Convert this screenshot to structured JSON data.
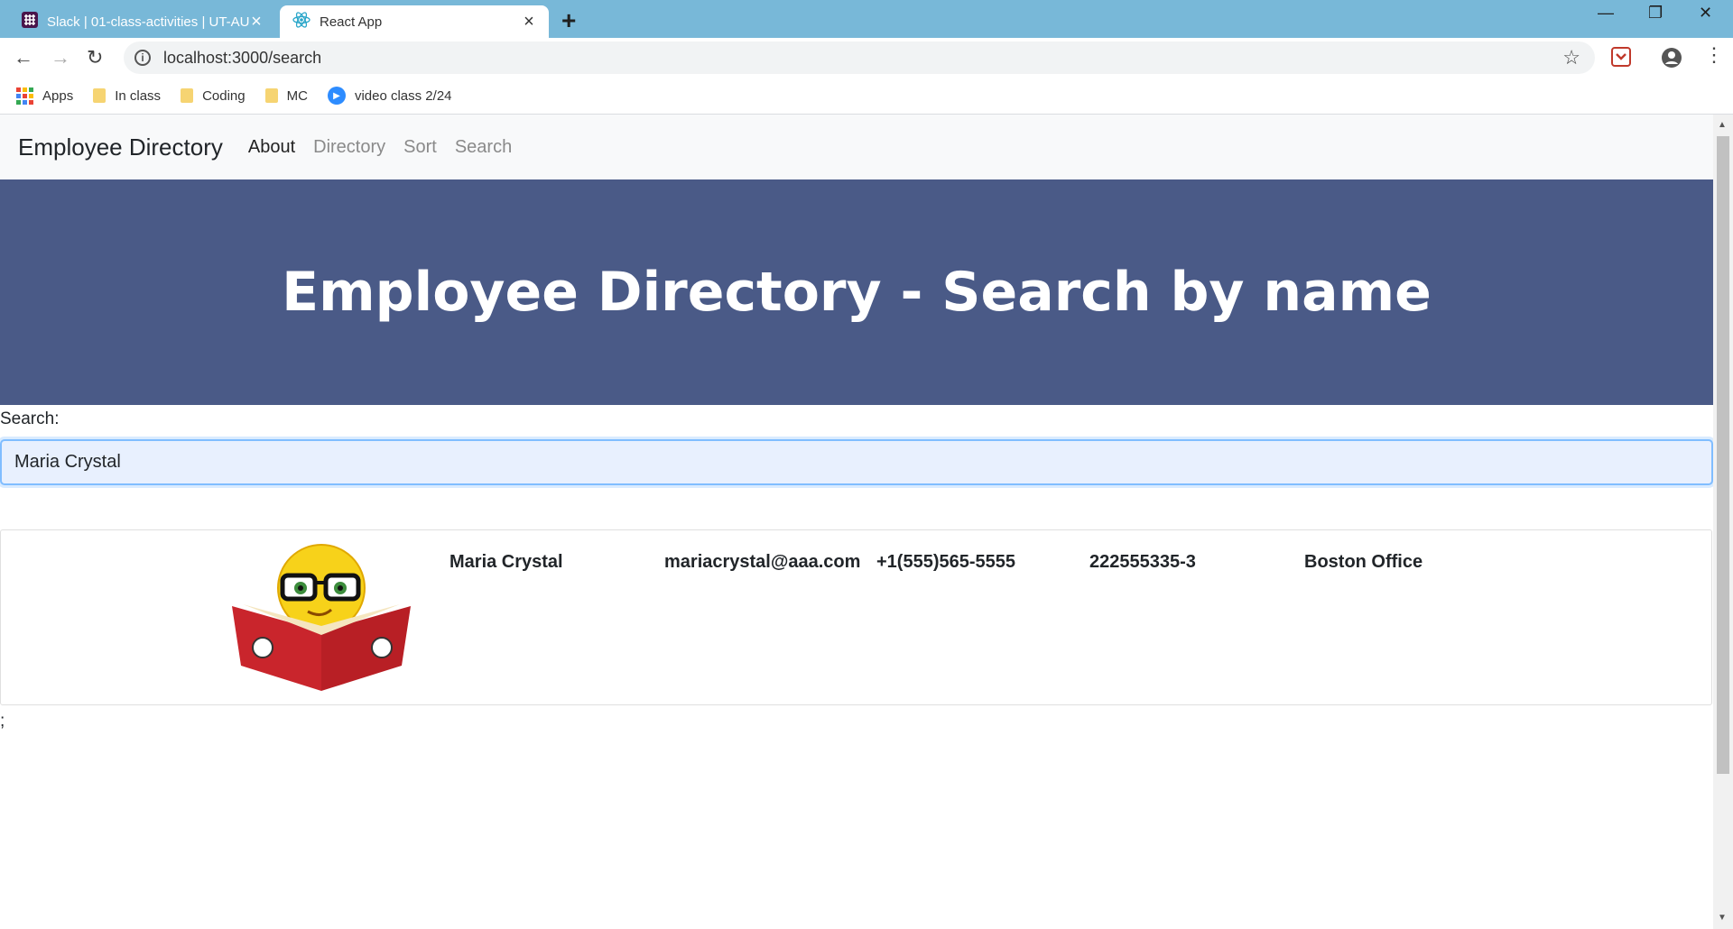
{
  "browser": {
    "tabs": [
      {
        "title": "Slack | 01-class-activities | UT-AU",
        "active": false
      },
      {
        "title": "React App",
        "active": true
      }
    ],
    "url": "localhost:3000/search",
    "bookmarks": [
      {
        "label": "Apps",
        "icon": "apps-grid-icon"
      },
      {
        "label": "In class",
        "icon": "folder-icon"
      },
      {
        "label": "Coding",
        "icon": "folder-icon"
      },
      {
        "label": "MC",
        "icon": "folder-icon"
      },
      {
        "label": "video class 2/24",
        "icon": "zoom-icon"
      }
    ]
  },
  "navbar": {
    "brand": "Employee Directory",
    "links": [
      {
        "label": "About",
        "active": true
      },
      {
        "label": "Directory",
        "active": false
      },
      {
        "label": "Sort",
        "active": false
      },
      {
        "label": "Search",
        "active": false
      }
    ]
  },
  "header": {
    "title": "Employee Directory - Search by name",
    "bg_color": "#4a5a87"
  },
  "search": {
    "label": "Search:",
    "value": "Maria Crystal"
  },
  "results": [
    {
      "avatar": "emoji-reading-book-icon",
      "name": "Maria Crystal",
      "email": "mariacrystal@aaa.com",
      "phone": "+1(555)565-5555",
      "id": "222555335-3",
      "office": "Boston Office"
    }
  ],
  "trailing_text": ";"
}
